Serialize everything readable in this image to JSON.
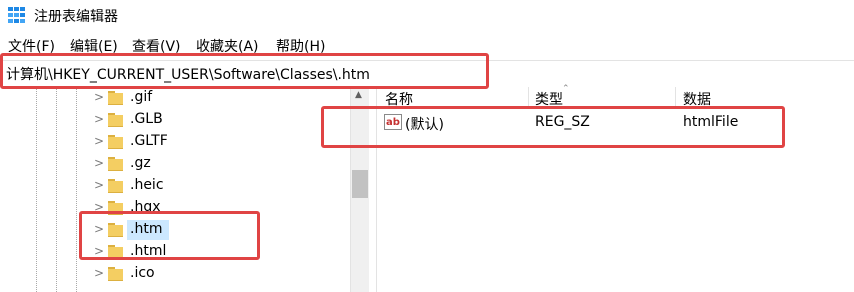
{
  "window": {
    "title": "注册表编辑器",
    "icon": "registry-editor-icon"
  },
  "menu": [
    {
      "label": "文件(F)"
    },
    {
      "label": "编辑(E)"
    },
    {
      "label": "查看(V)"
    },
    {
      "label": "收藏夹(A)"
    },
    {
      "label": "帮助(H)"
    }
  ],
  "address": {
    "path": "计算机\\HKEY_CURRENT_USER\\Software\\Classes\\.htm"
  },
  "tree": {
    "items": [
      {
        "label": ".gif"
      },
      {
        "label": ".GLB"
      },
      {
        "label": ".GLTF"
      },
      {
        "label": ".gz"
      },
      {
        "label": ".heic"
      },
      {
        "label": ".hqx"
      },
      {
        "label": ".htm",
        "selected": true
      },
      {
        "label": ".html"
      },
      {
        "label": ".ico"
      }
    ]
  },
  "values": {
    "columns": {
      "name": "名称",
      "type": "类型",
      "data": "数据"
    },
    "rows": [
      {
        "name": "(默认)",
        "type": "REG_SZ",
        "data": "htmlFile",
        "icon": "string-value-icon"
      }
    ]
  },
  "colors": {
    "highlight": "#e04444",
    "selection": "#cce8ff",
    "folder": "#f4ce62"
  }
}
